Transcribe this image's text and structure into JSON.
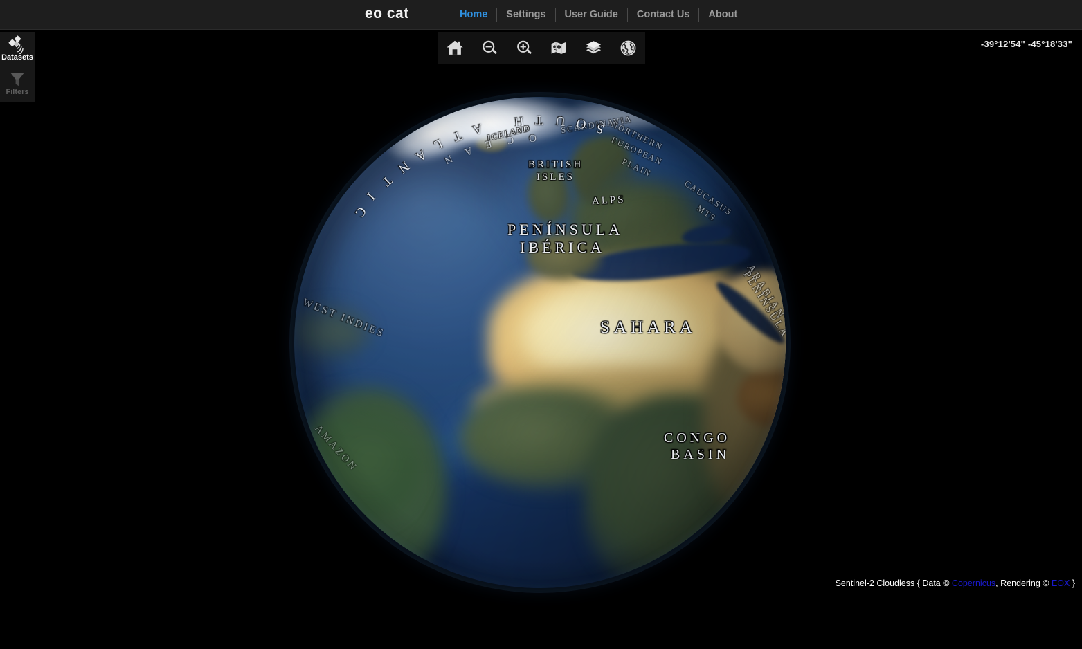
{
  "header": {
    "brand": "eo cat",
    "nav": [
      {
        "label": "Home",
        "active": true
      },
      {
        "label": "Settings",
        "active": false
      },
      {
        "label": "User Guide",
        "active": false
      },
      {
        "label": "Contact Us",
        "active": false
      },
      {
        "label": "About",
        "active": false
      }
    ]
  },
  "sidebar": {
    "items": [
      {
        "label": "Datasets",
        "icon": "satellite-icon",
        "state": "active"
      },
      {
        "label": "Filters",
        "icon": "funnel-icon",
        "state": "disabled"
      }
    ]
  },
  "toolbar": {
    "buttons": [
      {
        "name": "home-icon",
        "title": "Home"
      },
      {
        "name": "zoom-out-icon",
        "title": "Zoom Out"
      },
      {
        "name": "zoom-in-icon",
        "title": "Zoom In"
      },
      {
        "name": "map-icon",
        "title": "Map"
      },
      {
        "name": "layers-icon",
        "title": "Layers"
      },
      {
        "name": "globe-icon",
        "title": "Globe"
      }
    ]
  },
  "map": {
    "coordinates": "-39°12'54\" -45°18'33\"",
    "view": "globe",
    "labels": [
      {
        "text": "ICELAND",
        "size": "small"
      },
      {
        "text": "SCANDINAVIA",
        "size": "small"
      },
      {
        "text": "NORTHERN",
        "size": "small"
      },
      {
        "text": "EUROPEAN",
        "size": "small"
      },
      {
        "text": "PLAIN",
        "size": "small"
      },
      {
        "text": "BRITISH",
        "size": "mid"
      },
      {
        "text": "ISLES",
        "size": "mid"
      },
      {
        "text": "ALPS",
        "size": "mid"
      },
      {
        "text": "CAUCASUS",
        "size": "small"
      },
      {
        "text": "MTS",
        "size": "small"
      },
      {
        "text": "PENÍNSULA",
        "size": "big"
      },
      {
        "text": "IBÉRICA",
        "size": "big"
      },
      {
        "text": "SAHARA",
        "size": "huge"
      },
      {
        "text": "ARABIAN",
        "size": "mid"
      },
      {
        "text": "PENINSULA",
        "size": "mid"
      },
      {
        "text": "CONGO",
        "size": "big"
      },
      {
        "text": "BASIN",
        "size": "big"
      },
      {
        "text": "WEST INDIES",
        "size": "mid"
      },
      {
        "text": "AMAZON",
        "size": "mid"
      }
    ],
    "ocean_label": {
      "line1": "SOUTH",
      "line2": "ATLANTIC",
      "line3": "OCEAN"
    }
  },
  "attribution": {
    "prefix": "Sentinel-2 Cloudless { Data © ",
    "link1": "Copernicus",
    "middle": ", Rendering © ",
    "link2": "EOX",
    "suffix": " }"
  },
  "colors": {
    "header_bg": "#1e1e1e",
    "panel_bg": "#181818",
    "toolbar_bg": "#121212",
    "nav_active": "#2f8fdd",
    "nav_idle": "#9a9a9a",
    "link": "#1a1ad0",
    "canvas_bg": "#000000"
  }
}
